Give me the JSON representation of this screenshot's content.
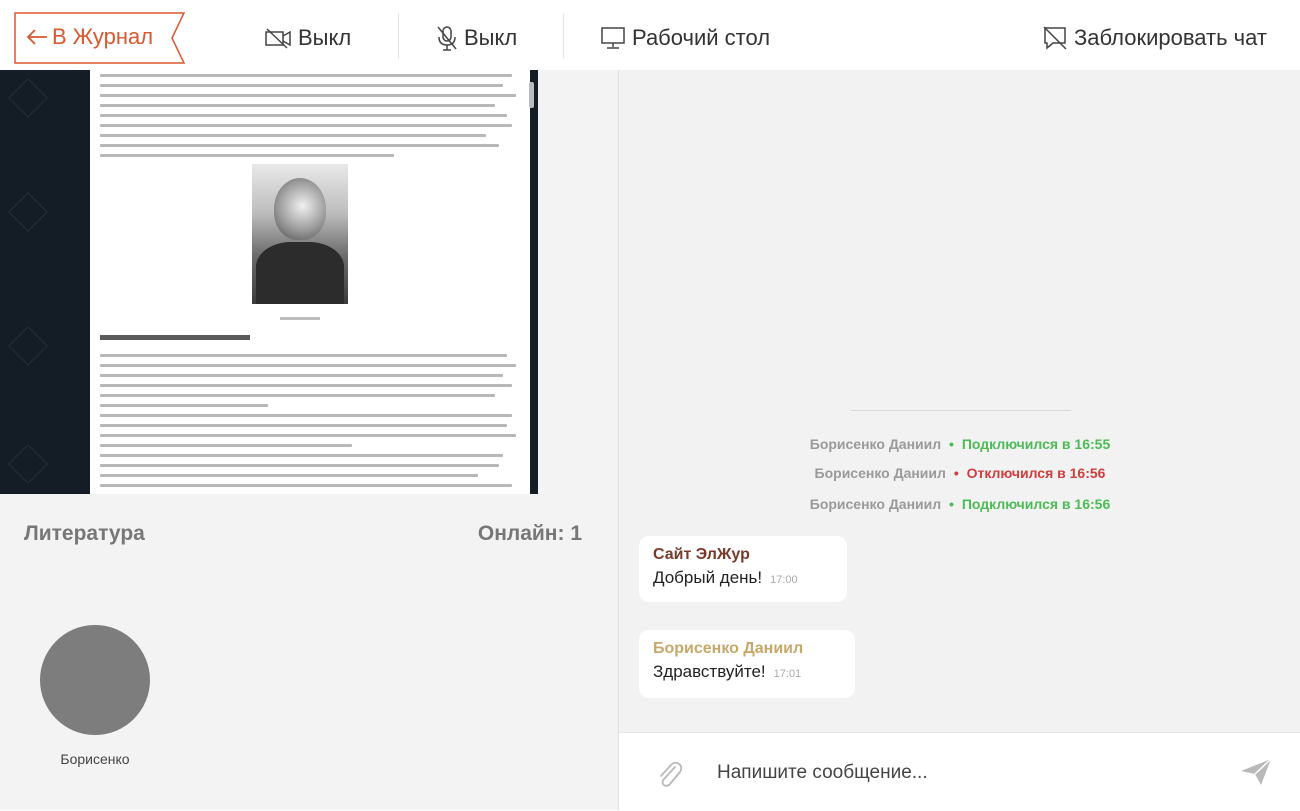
{
  "toolbar": {
    "back_label": "В Журнал",
    "camera_label": "Выкл",
    "mic_label": "Выкл",
    "desktop_label": "Рабочий стол",
    "block_chat_label": "Заблокировать чат"
  },
  "stream": {
    "subject": "Литература",
    "online_label": "Онлайн: 1"
  },
  "participants": [
    {
      "name": "Борисенко"
    }
  ],
  "chat": {
    "system_messages": [
      {
        "name": "Борисенко Даниил",
        "status": "Подключился в 16:55",
        "type": "connected"
      },
      {
        "name": "Борисенко Даниил",
        "status": "Отключился в 16:56",
        "type": "disconnected"
      },
      {
        "name": "Борисенко Даниил",
        "status": "Подключился в 16:56",
        "type": "connected"
      }
    ],
    "separator": "•",
    "messages": [
      {
        "author": "Сайт ЭлЖур",
        "text": "Добрый день!",
        "time": "17:00"
      },
      {
        "author": "Борисенко Даниил",
        "text": "Здравствуйте!",
        "time": "17:01"
      }
    ],
    "input_placeholder": "Напишите сообщение..."
  },
  "colors": {
    "accent": "#d9582f",
    "connected": "#4cbb55",
    "disconnected": "#cf3d3d",
    "author_site": "#7a3a2a",
    "author_user": "#c8a86a"
  },
  "icons": {
    "back": "arrow-left-icon",
    "camera": "camera-off-icon",
    "mic": "mic-off-icon",
    "desktop": "monitor-icon",
    "block": "chat-block-icon",
    "attach": "paperclip-icon",
    "send": "send-icon"
  }
}
